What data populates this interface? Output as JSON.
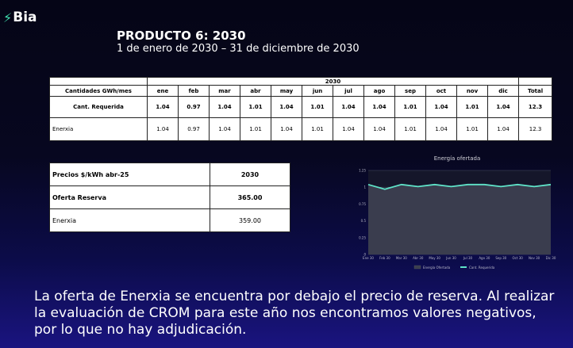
{
  "logo": {
    "bolt": "⚡",
    "text": "Bia"
  },
  "header": {
    "title": "PRODUCTO 6: 2030",
    "subtitle": "1 de enero de 2030  – 31 de diciembre de 2030"
  },
  "quantities_table": {
    "year": "2030",
    "label_header": "Cantidades GWh/mes",
    "months": [
      "ene",
      "feb",
      "mar",
      "abr",
      "may",
      "jun",
      "jul",
      "ago",
      "sep",
      "oct",
      "nov",
      "dic"
    ],
    "total_header": "Total",
    "rows": [
      {
        "label": "Cant. Requerida",
        "values": [
          "1.04",
          "0.97",
          "1.04",
          "1.01",
          "1.04",
          "1.01",
          "1.04",
          "1.04",
          "1.01",
          "1.04",
          "1.01",
          "1.04"
        ],
        "total": "12.3"
      },
      {
        "label": "Enerxia",
        "values": [
          "1.04",
          "0.97",
          "1.04",
          "1.01",
          "1.04",
          "1.01",
          "1.04",
          "1.04",
          "1.01",
          "1.04",
          "1.01",
          "1.04"
        ],
        "total": "12.3"
      }
    ]
  },
  "prices_table": {
    "header_label": "Precios $/kWh abr-25",
    "header_value": "2030",
    "rows": [
      {
        "label": "Oferta Reserva",
        "value": "365.00"
      },
      {
        "label": "Enerxia",
        "value": "359.00"
      }
    ]
  },
  "chart_data": {
    "type": "area",
    "title": "Energía ofertada",
    "categories": [
      "Ene 30",
      "Feb 30",
      "Mar 30",
      "Abr 30",
      "May 30",
      "Jun 30",
      "Jul 30",
      "Ago 30",
      "Sep 30",
      "Oct 30",
      "Nov 30",
      "Dic 30"
    ],
    "ylim": [
      0,
      1.25
    ],
    "yticks": [
      "0",
      "0.25",
      "0.5",
      "0.75",
      "1",
      "1.25"
    ],
    "grid": true,
    "legend_position": "bottom",
    "series": [
      {
        "name": "Energía Ofertada",
        "kind": "area",
        "color": "#3a3d4e",
        "values": [
          1.04,
          0.97,
          1.04,
          1.01,
          1.04,
          1.01,
          1.04,
          1.04,
          1.01,
          1.04,
          1.01,
          1.04
        ]
      },
      {
        "name": "Cant. Requerida",
        "kind": "line",
        "color": "#5fe3c8",
        "values": [
          1.04,
          0.97,
          1.04,
          1.01,
          1.04,
          1.01,
          1.04,
          1.04,
          1.01,
          1.04,
          1.01,
          1.04
        ]
      }
    ]
  },
  "footer": {
    "text": "La oferta de Enerxia se encuentra por debajo el precio de reserva. Al realizar la evaluación de CROM para este año nos encontramos valores negativos, por lo que no hay adjudicación."
  }
}
